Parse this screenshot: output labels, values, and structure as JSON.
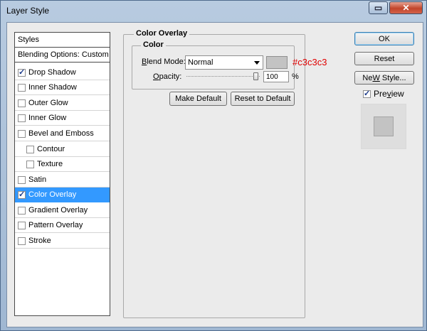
{
  "window": {
    "title": "Layer Style"
  },
  "styles_list": {
    "header": "Styles",
    "blending": "Blending Options: Custom",
    "items": [
      {
        "label": "Drop Shadow",
        "checked": true
      },
      {
        "label": "Inner Shadow",
        "checked": false
      },
      {
        "label": "Outer Glow",
        "checked": false
      },
      {
        "label": "Inner Glow",
        "checked": false
      },
      {
        "label": "Bevel and Emboss",
        "checked": false
      },
      {
        "label": "Contour",
        "checked": false
      },
      {
        "label": "Texture",
        "checked": false
      },
      {
        "label": "Satin",
        "checked": false
      },
      {
        "label": "Color Overlay",
        "checked": true,
        "selected": true
      },
      {
        "label": "Gradient Overlay",
        "checked": false
      },
      {
        "label": "Pattern Overlay",
        "checked": false
      },
      {
        "label": "Stroke",
        "checked": false
      }
    ]
  },
  "panel": {
    "title": "Color Overlay",
    "color_group": "Color",
    "blend_mode_label_u": "B",
    "blend_mode_label_rest": "lend Mode:",
    "blend_mode_value": "Normal",
    "swatch_color": "#c3c3c3",
    "hex_text": "#c3c3c3",
    "opacity_label_u": "O",
    "opacity_label_rest": "pacity:",
    "opacity_value": "100",
    "opacity_unit": "%",
    "make_default": "Make Default",
    "reset_default": "Reset to Default"
  },
  "buttons": {
    "ok": "OK",
    "reset": "Reset",
    "new_style_u": "W",
    "new_style_pre": "Ne",
    "new_style_post": " Style...",
    "preview_u": "v",
    "preview_pre": "Pre",
    "preview_post": "iew",
    "preview_checked": true
  },
  "colors": {
    "accent_selected": "#3399ff",
    "hex_text_color": "#e00000"
  }
}
